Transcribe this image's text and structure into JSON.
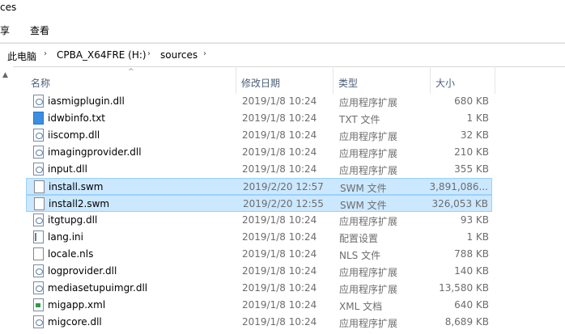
{
  "window": {
    "title": "ces"
  },
  "ribbon": {
    "tabs": [
      "享",
      "查看"
    ]
  },
  "address": {
    "crumbs": [
      "此电脑",
      "CPBA_X64FRE (H:)",
      "sources"
    ]
  },
  "columns": {
    "name": "名称",
    "date": "修改日期",
    "type": "类型",
    "size": "大小"
  },
  "files": [
    {
      "name": "iasmigplugin.dll",
      "date": "2019/1/8 10:24",
      "type": "应用程序扩展",
      "size": "680 KB",
      "icon": "dll",
      "selected": false
    },
    {
      "name": "idwbinfo.txt",
      "date": "2019/1/8 10:24",
      "type": "TXT 文件",
      "size": "1 KB",
      "icon": "txt",
      "selected": false
    },
    {
      "name": "iiscomp.dll",
      "date": "2019/1/8 10:24",
      "type": "应用程序扩展",
      "size": "32 KB",
      "icon": "dll",
      "selected": false
    },
    {
      "name": "imagingprovider.dll",
      "date": "2019/1/8 10:24",
      "type": "应用程序扩展",
      "size": "210 KB",
      "icon": "dll",
      "selected": false
    },
    {
      "name": "input.dll",
      "date": "2019/1/8 10:24",
      "type": "应用程序扩展",
      "size": "355 KB",
      "icon": "dll",
      "selected": false
    },
    {
      "name": "install.swm",
      "date": "2019/2/20 12:57",
      "type": "SWM 文件",
      "size": "3,891,086...",
      "icon": "swm",
      "selected": true
    },
    {
      "name": "install2.swm",
      "date": "2019/2/20 12:55",
      "type": "SWM 文件",
      "size": "326,053 KB",
      "icon": "swm",
      "selected": true
    },
    {
      "name": "itgtupg.dll",
      "date": "2019/1/8 10:24",
      "type": "应用程序扩展",
      "size": "93 KB",
      "icon": "dll",
      "selected": false
    },
    {
      "name": "lang.ini",
      "date": "2019/1/8 10:24",
      "type": "配置设置",
      "size": "1 KB",
      "icon": "ini",
      "selected": false
    },
    {
      "name": "locale.nls",
      "date": "2019/1/8 10:24",
      "type": "NLS 文件",
      "size": "788 KB",
      "icon": "nls",
      "selected": false
    },
    {
      "name": "logprovider.dll",
      "date": "2019/1/8 10:24",
      "type": "应用程序扩展",
      "size": "140 KB",
      "icon": "dll",
      "selected": false
    },
    {
      "name": "mediasetupuimgr.dll",
      "date": "2019/1/8 10:24",
      "type": "应用程序扩展",
      "size": "13,580 KB",
      "icon": "dll",
      "selected": false
    },
    {
      "name": "migapp.xml",
      "date": "2019/1/8 10:24",
      "type": "XML 文档",
      "size": "640 KB",
      "icon": "xml",
      "selected": false
    },
    {
      "name": "migcore.dll",
      "date": "2019/1/8 10:24",
      "type": "应用程序扩展",
      "size": "8,689 KB",
      "icon": "dll",
      "selected": false
    }
  ]
}
